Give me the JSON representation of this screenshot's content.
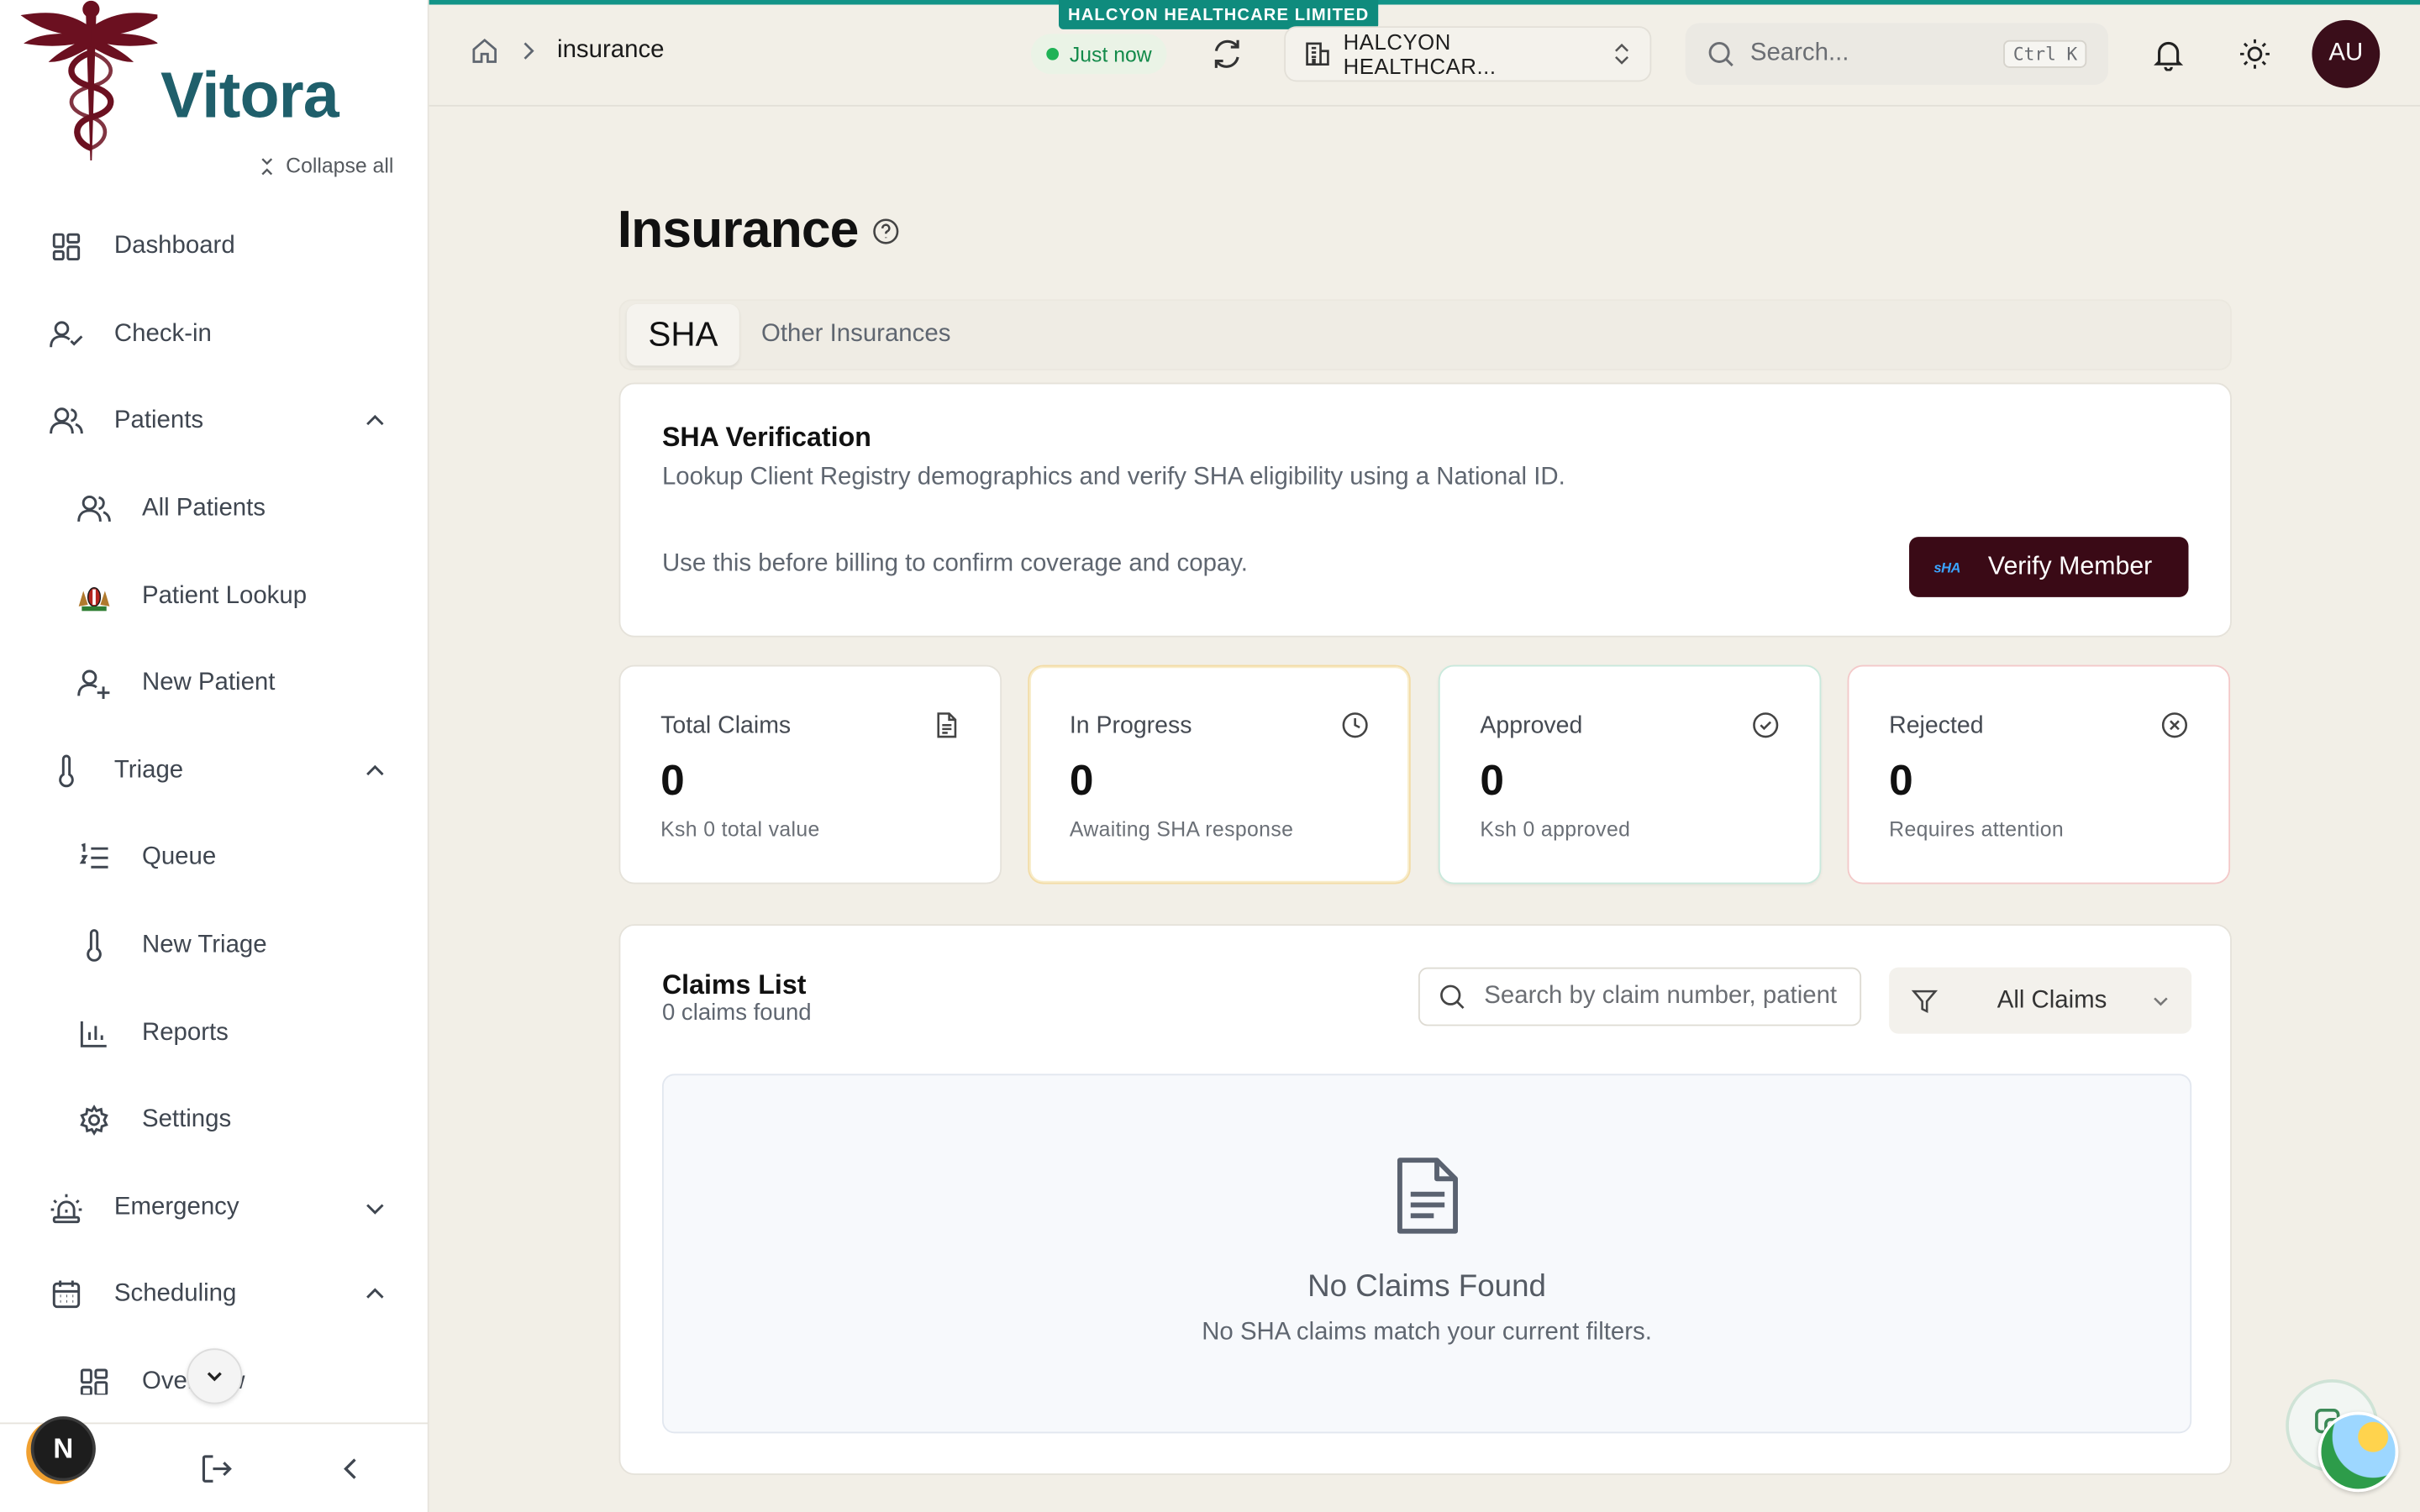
{
  "app": {
    "logo_text": "Vitora",
    "org_tag": "HALCYON HEALTHCARE LIMITED"
  },
  "sidebar": {
    "collapse_all": "Collapse all",
    "items": [
      {
        "label": "Dashboard",
        "icon": "dashboard-icon",
        "level": 0,
        "chevron": ""
      },
      {
        "label": "Check-in",
        "icon": "user-check-icon",
        "level": 0,
        "chevron": ""
      },
      {
        "label": "Patients",
        "icon": "users-icon",
        "level": 0,
        "chevron": "up"
      },
      {
        "label": "All Patients",
        "icon": "users-icon",
        "level": 1,
        "chevron": ""
      },
      {
        "label": "Patient Lookup",
        "icon": "kenya-emblem-icon",
        "level": 1,
        "chevron": ""
      },
      {
        "label": "New Patient",
        "icon": "user-plus-icon",
        "level": 1,
        "chevron": ""
      },
      {
        "label": "Triage",
        "icon": "thermometer-icon",
        "level": 0,
        "chevron": "up"
      },
      {
        "label": "Queue",
        "icon": "list-ordered-icon",
        "level": 1,
        "chevron": ""
      },
      {
        "label": "New Triage",
        "icon": "thermometer-icon",
        "level": 1,
        "chevron": ""
      },
      {
        "label": "Reports",
        "icon": "bar-chart-icon",
        "level": 1,
        "chevron": ""
      },
      {
        "label": "Settings",
        "icon": "gear-icon",
        "level": 1,
        "chevron": ""
      },
      {
        "label": "Emergency",
        "icon": "siren-icon",
        "level": 0,
        "chevron": "down"
      },
      {
        "label": "Scheduling",
        "icon": "calendar-icon",
        "level": 0,
        "chevron": "up"
      },
      {
        "label": "Overview",
        "icon": "dashboard-icon",
        "level": 1,
        "chevron": ""
      }
    ],
    "user_badge": "N"
  },
  "topbar": {
    "breadcrumb_current": "insurance",
    "sync_status": "Just now",
    "org_select": "HALCYON HEALTHCAR...",
    "search_placeholder": "Search...",
    "search_shortcut": "Ctrl K",
    "avatar_initials": "AU"
  },
  "page": {
    "title": "Insurance",
    "tabs": [
      {
        "label": "SHA",
        "active": true
      },
      {
        "label": "Other Insurances",
        "active": false
      }
    ]
  },
  "sha_card": {
    "title": "SHA Verification",
    "description": "Lookup Client Registry demographics and verify SHA eligibility using a National ID.",
    "note": "Use this before billing to confirm coverage and copay.",
    "button_logo": "sHA",
    "button_label": "Verify Member"
  },
  "stats": {
    "total": {
      "label": "Total Claims",
      "value": "0",
      "sub": "Ksh 0 total value",
      "icon": "file-text-icon"
    },
    "in_progress": {
      "label": "In Progress",
      "value": "0",
      "sub": "Awaiting SHA response",
      "icon": "clock-icon",
      "accent": "#f3dca6"
    },
    "approved": {
      "label": "Approved",
      "value": "0",
      "sub": "Ksh 0 approved",
      "icon": "check-circle-icon",
      "accent": "#c9e9dc"
    },
    "rejected": {
      "label": "Rejected",
      "value": "0",
      "sub": "Requires attention",
      "icon": "x-circle-icon",
      "accent": "#f3c9c9"
    }
  },
  "claims": {
    "title": "Claims List",
    "count": "0 claims found",
    "search_placeholder": "Search by claim number, patient",
    "filter_value": "All Claims",
    "empty_title": "No Claims Found",
    "empty_sub": "No SHA claims match your current filters."
  },
  "colors": {
    "accent_teal": "#129488",
    "primary_button": "#3a0a16",
    "avatar": "#3a0e1a",
    "logo_text": "#1f5f6b",
    "logo_emblem": "#6b1020"
  }
}
